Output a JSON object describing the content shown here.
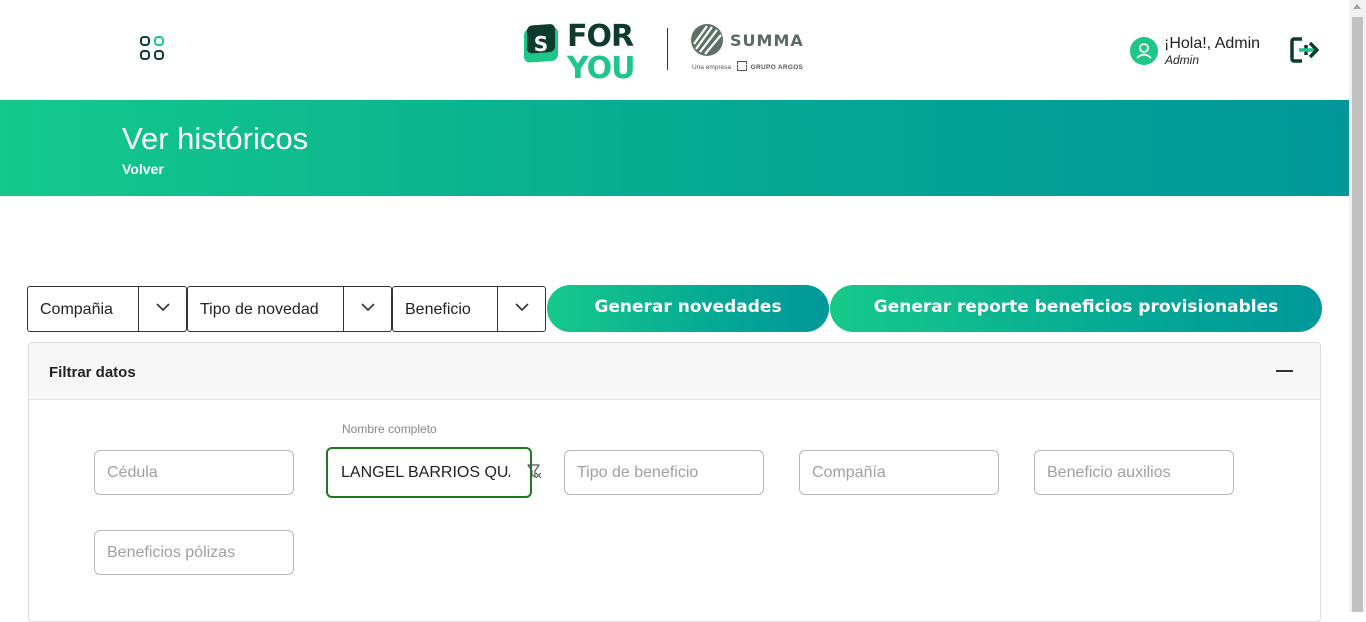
{
  "header": {
    "logo_text_top": "FOR",
    "logo_text_bottom": "YOU",
    "logo_badge": "S",
    "partner_name": "SUMMA",
    "partner_sub_prefix": "Una empresa",
    "partner_sub_group": "GRUPO ARGOS",
    "greeting": "¡Hola!, Admin",
    "role": "Admin",
    "accent_color": "#1fc68a"
  },
  "hero": {
    "title": "Ver históricos",
    "back_label": "Volver"
  },
  "toolbar": {
    "selects": [
      {
        "label": "Compañia"
      },
      {
        "label": "Tipo de novedad"
      },
      {
        "label": "Beneficio"
      }
    ],
    "generate_label": "Generar novedades",
    "report_label": "Generar reporte beneficios provisionables"
  },
  "filters": {
    "title": "Filtrar datos",
    "cedula_placeholder": "Cédula",
    "nombre_label": "Nombre completo",
    "nombre_value": "LANGEL BARRIOS QUANT",
    "tipo_beneficio_placeholder": "Tipo de beneficio",
    "compania_placeholder": "Compañía",
    "auxilios_placeholder": "Beneficio auxilios",
    "polizas_placeholder": "Beneficios pólizas"
  }
}
